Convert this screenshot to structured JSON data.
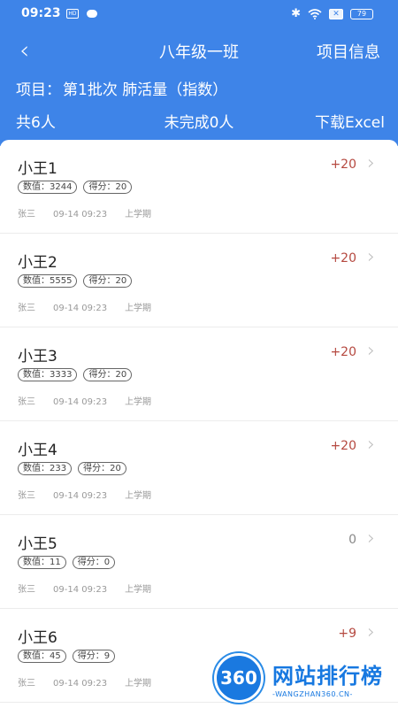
{
  "status_bar": {
    "time": "09:23",
    "hd": "HD",
    "battery": "79",
    "icons": [
      "cloud-icon",
      "bluetooth-icon",
      "wifi-icon",
      "sim-x-icon",
      "battery-icon"
    ]
  },
  "nav": {
    "back_icon": "chevron-left-icon",
    "title": "八年级一班",
    "right_action": "项目信息"
  },
  "project": {
    "label": "项目：",
    "value": "第1批次 肺活量（指数）"
  },
  "summary": {
    "total": "共6人",
    "pending": "未完成0人",
    "download": "下载Excel"
  },
  "students": [
    {
      "name": "小王1",
      "value_tag": "数值：3244",
      "score_tag": "得分：20",
      "teacher": "张三",
      "time": "09-14 09:23",
      "term": "上学期",
      "score": "+20"
    },
    {
      "name": "小王2",
      "value_tag": "数值：5555",
      "score_tag": "得分：20",
      "teacher": "张三",
      "time": "09-14 09:23",
      "term": "上学期",
      "score": "+20"
    },
    {
      "name": "小王3",
      "value_tag": "数值：3333",
      "score_tag": "得分：20",
      "teacher": "张三",
      "time": "09-14 09:23",
      "term": "上学期",
      "score": "+20"
    },
    {
      "name": "小王4",
      "value_tag": "数值：233",
      "score_tag": "得分：20",
      "teacher": "张三",
      "time": "09-14 09:23",
      "term": "上学期",
      "score": "+20"
    },
    {
      "name": "小王5",
      "value_tag": "数值：11",
      "score_tag": "得分：0",
      "teacher": "张三",
      "time": "09-14 09:23",
      "term": "上学期",
      "score": "0"
    },
    {
      "name": "小王6",
      "value_tag": "数值：45",
      "score_tag": "得分：9",
      "teacher": "张三",
      "time": "09-14 09:23",
      "term": "上学期",
      "score": "+9"
    }
  ],
  "watermark": {
    "logo": "360",
    "title": "网站排行榜",
    "subtitle": "-WANGZHAN360.CN-"
  },
  "colors": {
    "header_blue": "#3e84e8",
    "score_red": "#b5483f",
    "watermark_blue": "#1778e0"
  }
}
